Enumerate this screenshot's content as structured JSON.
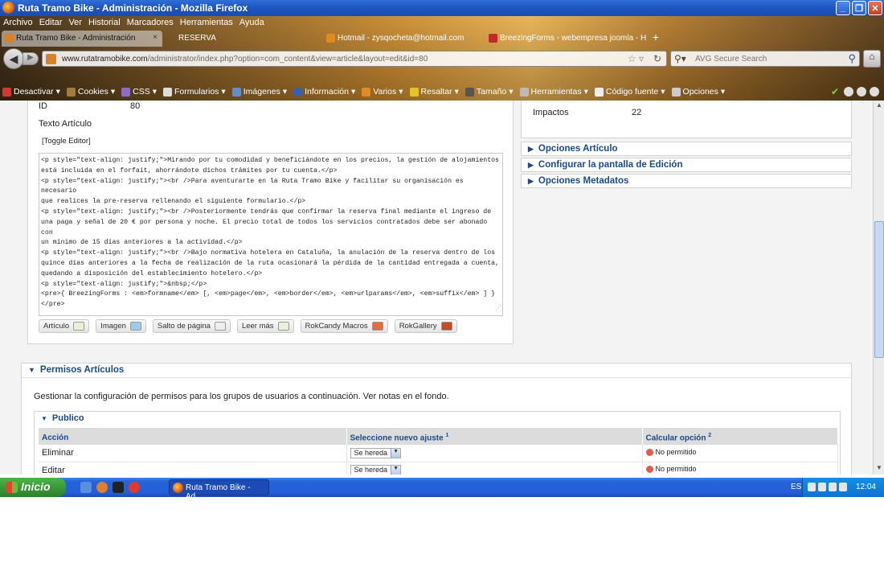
{
  "window": {
    "title": "Ruta Tramo Bike - Administración - Mozilla Firefox",
    "controls": [
      "_",
      "❐",
      "✕"
    ]
  },
  "menu": [
    "Archivo",
    "Editar",
    "Ver",
    "Historial",
    "Marcadores",
    "Herramientas",
    "Ayuda"
  ],
  "tabs": [
    {
      "label": "Ruta Tramo Bike - Administración",
      "close": "×"
    },
    {
      "label": "RESERVA"
    },
    {
      "label": "Hotmail - zysqocheta@hotmail.com"
    },
    {
      "label": "BreezingForms - webempresa joomla - Ho..."
    }
  ],
  "newtab": "+",
  "nav": {
    "url_host": "www.rutatramobike.com",
    "url_path": "/administrator/index.php?option=com_content&view=article&layout=edit&id=80",
    "search_placeholder": "AVG Secure Search"
  },
  "webdev_toolbar": [
    "Desactivar",
    "Cookies",
    "CSS",
    "Formularios",
    "Imágenes",
    "Información",
    "Varios",
    "Resaltar",
    "Tamaño",
    "Herramientas",
    "Código fuente",
    "Opciones"
  ],
  "article": {
    "id_label": "ID",
    "id_value": "80",
    "text_label": "Texto Artículo",
    "toggle_editor": "[Toggle Editor]",
    "editor_content": "<p style=\"text-align: justify;\">Mirando por tu comodidad y beneficiándote en los precios, la gestión de alojamientos\nestá incluida en el forfait, ahorrándote dichos trámites por tu cuenta.</p>\n<p style=\"text-align: justify;\"><br />Para aventurarte en la Ruta Tramo Bike y facilitar su organisación es necesario\nque realices la pre-reserva rellenando el siguiente formulario.</p>\n<p style=\"text-align: justify;\"><br />Posteriormente tendrás que confirmar la reserva final mediante el ingreso de\nuna paga y señal de 20 € por persona y noche. El precio total de todos los servicios contratados debe ser abonado con\nun mínimo de 15 días anteriores a la actividad.</p>\n<p style=\"text-align: justify;\"><br />Bajo normativa hotelera en Cataluña, la anulación de la reserva dentro de los\nquince días anteriores a la fecha de realización de la ruta ocasionará la pérdida de la cantidad entregada a cuenta,\nquedando a disposición del establecimiento hotelero.</p>\n<p style=\"text-align: justify;\">&nbsp;</p>\n<pre>{ BreezingForms : <em>formname</em> [, <em>page</em>, <em>border</em>, <em>urlparams</em>, <em>suffix</em> ] }\n</pre>",
    "editor_buttons": [
      "Artículo",
      "Imagen",
      "Salto de página",
      "Leer más",
      "RokCandy Macros",
      "RokGallery"
    ]
  },
  "sidebar": {
    "impactos_label": "Impactos",
    "impactos_value": "22",
    "accordions": [
      "Opciones Artículo",
      "Configurar la pantalla de Edición",
      "Opciones Metadatos"
    ]
  },
  "permissions": {
    "title": "Permisos Artículos",
    "description": "Gestionar la configuración de permisos para los grupos de usuarios a continuación. Ver notas en el fondo.",
    "group": "Publico",
    "columns": {
      "action": "Acción",
      "new_setting": "Seleccione nuevo ajuste",
      "new_setting_note": "1",
      "calc": "Calcular opción",
      "calc_note": "2"
    },
    "rows": [
      {
        "action": "Eliminar",
        "setting": "Se hereda",
        "calc": "No permitido"
      },
      {
        "action": "Editar",
        "setting": "Se hereda",
        "calc": "No permitido"
      }
    ]
  },
  "taskbar": {
    "start": "Inicio",
    "task": "Ruta Tramo Bike - Ad...",
    "lang": "ES",
    "clock": "12:04"
  }
}
